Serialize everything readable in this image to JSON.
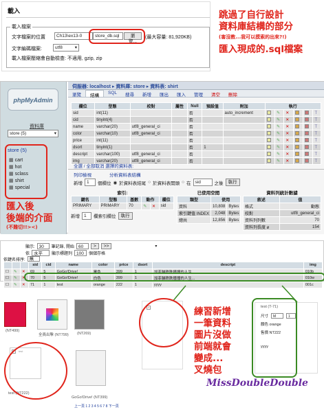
{
  "import_panel": {
    "title": "載入",
    "fieldset_legend": "載入檔案",
    "file_label": "文字檔案的位置",
    "file_value": "Ch13\\ex13-0",
    "file_name": "store_db.sql",
    "browse_label": "瀏覽...",
    "max_size": "(最大容量: 81,920KB)",
    "encoding_label": "文字編碼檔案:",
    "encoding_value": "utf8",
    "compression_note": "載入檔案壓縮會自動檢查: 不適用, gzip, zip"
  },
  "annotations": {
    "top_right_1": "跳過了自行設計",
    "top_right_2": "資料庫結構的部分",
    "top_right_3": "(害沒教...我可以摸索的出來?!)",
    "top_right_4": "匯入現成的.sql檔案",
    "sidebar_1": "匯入後",
    "sidebar_2": "後端的介面",
    "sidebar_3": "(不難切!!><)",
    "bottom_1": "練習新增",
    "bottom_2": "一筆資料",
    "bottom_3": "圖片沒做",
    "bottom_4": "前端就會",
    "bottom_5": "變成...",
    "bottom_6": "叉燒包",
    "signature": "MissDoubleDouble"
  },
  "pma": {
    "logo": "phpMyAdmin",
    "db_label": "資料庫",
    "db_select": "store (5)",
    "breadcrumb": "伺服器: localhost ▸ 資料庫: store ▸ 資料表: shirt",
    "tabs": [
      "瀏覽",
      "結構",
      "SQL",
      "搜尋",
      "新增",
      "匯出",
      "匯入",
      "管理",
      "清空",
      "刪除"
    ],
    "tree_title": "store (5)",
    "tables": [
      "cart",
      "hot",
      "sclass",
      "shirt",
      "special"
    ],
    "columns_header": [
      "欄位",
      "型態",
      "校對",
      "屬性",
      "Null",
      "預設值",
      "附加",
      "執行"
    ],
    "fields": [
      {
        "name": "sid",
        "type": "int(11)",
        "collation": "",
        "nul": "否",
        "extra": "auto_increment"
      },
      {
        "name": "cid",
        "type": "tinyint(4)",
        "collation": "",
        "nul": "否",
        "extra": ""
      },
      {
        "name": "name",
        "type": "varchar(20)",
        "collation": "utf8_general_ci",
        "nul": "否",
        "extra": ""
      },
      {
        "name": "color",
        "type": "varchar(10)",
        "collation": "utf8_general_ci",
        "nul": "否",
        "extra": ""
      },
      {
        "name": "price",
        "type": "int(11)",
        "collation": "",
        "nul": "否",
        "extra": ""
      },
      {
        "name": "dsort",
        "type": "tinyint(1)",
        "collation": "",
        "nul": "否",
        "default": "1",
        "extra": ""
      },
      {
        "name": "descript",
        "type": "varchar(100)",
        "collation": "utf8_general_ci",
        "nul": "否",
        "extra": ""
      },
      {
        "name": "img",
        "type": "varchar(20)",
        "collation": "utf8_general_ci",
        "nul": "否",
        "extra": ""
      }
    ],
    "check_all": "全選 / 全部取消 選擇的資料表:",
    "print_view": "列印檢視",
    "analyze": "分析資料表結構",
    "add_field": "新增",
    "add_field_count": "1",
    "add_field_unit": "個欄位",
    "pos_end": "於資料表結尾",
    "pos_start": "於資料表開頭",
    "pos_after": "在",
    "pos_after_select": "sid",
    "pos_after_suffix": "之後",
    "go": "執行",
    "index_title": "索引:",
    "index_header": [
      "鍵名",
      "型態",
      "基數",
      "動作",
      "欄位"
    ],
    "index_row": {
      "key": "PRIMARY",
      "type": "PRIMARY",
      "card": "70",
      "field": "sid"
    },
    "create_index": "新增",
    "create_index_count": "1",
    "create_index_unit": "欄索引欄位",
    "space_title": "已使用空間",
    "space_header": [
      "類型",
      "使用"
    ],
    "space_rows": [
      [
        "資料",
        "10,808",
        "Bytes"
      ],
      [
        "索引鍵值 INDEX",
        "2,048",
        "Bytes"
      ],
      [
        "總共",
        "12,856",
        "Bytes"
      ]
    ],
    "stats_title": "資料列統計數據",
    "stats_header": [
      "敘述",
      "值"
    ],
    "stats_rows": [
      [
        "格式",
        "動態"
      ],
      [
        "校對",
        "utf8_general_ci"
      ],
      [
        "資料列列數",
        "70"
      ],
      [
        "資料列長度 ø",
        "154"
      ]
    ]
  },
  "browse": {
    "show_label": "顯示:",
    "show_count": "30",
    "rows_from": "筆記錄, 開始",
    "start": "60",
    "mode_label": "依",
    "mode": "水平",
    "headers_repeat": "顯示標題列",
    "repeat_after": "100",
    "repeat_unit": "個儲存格",
    "sort_label": "依鍵名排序:",
    "sort_value": "無",
    "columns": [
      "sid",
      "cid",
      "name",
      "color",
      "price",
      "dsort",
      "descript",
      "img"
    ],
    "rows": [
      {
        "sid": "69",
        "cid": "5",
        "name": "GoGo!Drive!",
        "color": "黑色",
        "price": "399",
        "dsort": "1",
        "descript": "加菲貓跌跌撞撞的人生...",
        "img": "010b"
      },
      {
        "sid": "70",
        "cid": "5",
        "name": "GoGo!Drive!",
        "color": "白色",
        "price": "399",
        "dsort": "1",
        "descript": "加菲貓跌跌撞撞的人生...",
        "img": "010w"
      },
      {
        "sid": "71",
        "cid": "1",
        "name": "test",
        "color": "orange",
        "price": "222",
        "dsort": "1",
        "descript": "yyyy",
        "img": "001c"
      }
    ]
  },
  "shop": {
    "p1": "(NT499)",
    "p2_name": "全員出擊 (NT799)",
    "p3": "(NT269)",
    "new_item": "test (NT222)",
    "p4": "GoGo!Drive! (NT399)",
    "pagination": "上一頁 1 2 3 4 5 6 7 8 下一頁"
  },
  "detail": {
    "title": "test (T-71)",
    "size_label": "尺寸",
    "size_value": "M",
    "color_label": "顏色",
    "color_value": "orange",
    "price_label": "售價",
    "price_value": "NT222",
    "desc": "yyyy"
  }
}
